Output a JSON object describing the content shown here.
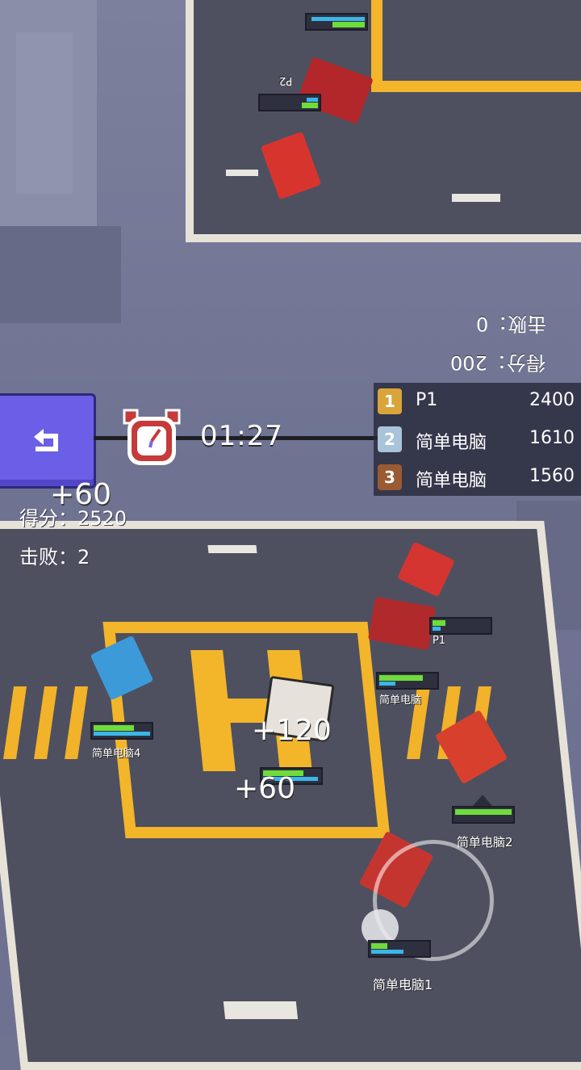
{
  "hud": {
    "timer": "01:27",
    "score_label": "得分：",
    "score_value": "2520",
    "kills_label": "击败：",
    "kills_value": "2",
    "floating_top": "+60",
    "floating_mid": "+120",
    "floating_low": "+60"
  },
  "opponent_hud": {
    "score_text": "得分：200",
    "kills_text": "击败：0",
    "player_tag": "P2"
  },
  "leaderboard": [
    {
      "rank": "1",
      "name": "P1",
      "score": "2400",
      "medal_color": "#d9a53a"
    },
    {
      "rank": "2",
      "name": "简单电脑",
      "score": "1610",
      "medal_color": "#a9c3d8"
    },
    {
      "rank": "3",
      "name": "简单电脑",
      "score": "1560",
      "medal_color": "#9a5a32"
    }
  ],
  "cars": {
    "label_p1": "P1",
    "label_cpu1": "简单电脑1",
    "label_cpu2": "简单电脑2",
    "label_cpu4": "简单电脑4",
    "label_cpu_other": "简单电脑"
  },
  "icons": {
    "back": "back-arrow-icon",
    "clock": "alarm-clock-icon"
  }
}
